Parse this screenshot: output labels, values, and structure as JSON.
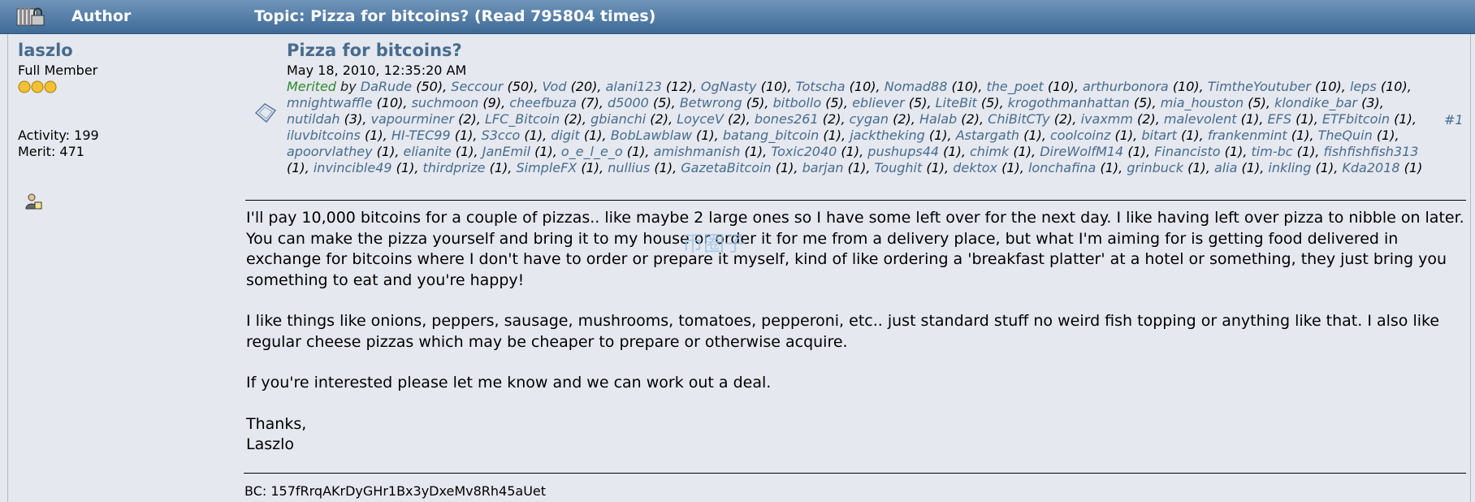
{
  "header": {
    "author_label": "Author",
    "topic_label": "Topic: Pizza for bitcoins?  (Read 795804 times)"
  },
  "poster": {
    "name": "laszlo",
    "rank": "Full Member",
    "star_count": 3,
    "activity": "Activity: 199",
    "merit": "Merit: 471"
  },
  "post": {
    "title": "Pizza for bitcoins?",
    "date": "May 18, 2010, 12:35:20 AM",
    "merited_label": "Merited",
    "merited_by_word": "by",
    "post_number": "#1",
    "merits": [
      {
        "user": "DaRude",
        "n": "(50)"
      },
      {
        "user": "Seccour",
        "n": "(50)"
      },
      {
        "user": "Vod",
        "n": "(20)"
      },
      {
        "user": "alani123",
        "n": "(12)"
      },
      {
        "user": "OgNasty",
        "n": "(10)"
      },
      {
        "user": "Totscha",
        "n": "(10)"
      },
      {
        "user": "Nomad88",
        "n": "(10)"
      },
      {
        "user": "the_poet",
        "n": "(10)"
      },
      {
        "user": "arthurbonora",
        "n": "(10)"
      },
      {
        "user": "TimtheYoutuber",
        "n": "(10)"
      },
      {
        "user": "leps",
        "n": "(10)"
      },
      {
        "user": "mnightwaffle",
        "n": "(10)"
      },
      {
        "user": "suchmoon",
        "n": "(9)"
      },
      {
        "user": "cheefbuza",
        "n": "(7)"
      },
      {
        "user": "d5000",
        "n": "(5)"
      },
      {
        "user": "Betwrong",
        "n": "(5)"
      },
      {
        "user": "bitbollo",
        "n": "(5)"
      },
      {
        "user": "ebliever",
        "n": "(5)"
      },
      {
        "user": "LiteBit",
        "n": "(5)"
      },
      {
        "user": "krogothmanhattan",
        "n": "(5)"
      },
      {
        "user": "mia_houston",
        "n": "(5)"
      },
      {
        "user": "klondike_bar",
        "n": "(3)"
      },
      {
        "user": "nutildah",
        "n": "(3)"
      },
      {
        "user": "vapourminer",
        "n": "(2)"
      },
      {
        "user": "LFC_Bitcoin",
        "n": "(2)"
      },
      {
        "user": "gbianchi",
        "n": "(2)"
      },
      {
        "user": "LoyceV",
        "n": "(2)"
      },
      {
        "user": "bones261",
        "n": "(2)"
      },
      {
        "user": "cygan",
        "n": "(2)"
      },
      {
        "user": "Halab",
        "n": "(2)"
      },
      {
        "user": "ChiBitCTy",
        "n": "(2)"
      },
      {
        "user": "ivaxmm",
        "n": "(2)"
      },
      {
        "user": "malevolent",
        "n": "(1)"
      },
      {
        "user": "EFS",
        "n": "(1)"
      },
      {
        "user": "ETFbitcoin",
        "n": "(1)"
      },
      {
        "user": "iluvbitcoins",
        "n": "(1)"
      },
      {
        "user": "HI-TEC99",
        "n": "(1)"
      },
      {
        "user": "S3cco",
        "n": "(1)"
      },
      {
        "user": "digit",
        "n": "(1)"
      },
      {
        "user": "BobLawblaw",
        "n": "(1)"
      },
      {
        "user": "batang_bitcoin",
        "n": "(1)"
      },
      {
        "user": "jacktheking",
        "n": "(1)"
      },
      {
        "user": "Astargath",
        "n": "(1)"
      },
      {
        "user": "coolcoinz",
        "n": "(1)"
      },
      {
        "user": "bitart",
        "n": "(1)"
      },
      {
        "user": "frankenmint",
        "n": "(1)"
      },
      {
        "user": "TheQuin",
        "n": "(1)"
      },
      {
        "user": "apoorvlathey",
        "n": "(1)"
      },
      {
        "user": "elianite",
        "n": "(1)"
      },
      {
        "user": "JanEmil",
        "n": "(1)"
      },
      {
        "user": "o_e_l_e_o",
        "n": "(1)"
      },
      {
        "user": "amishmanish",
        "n": "(1)"
      },
      {
        "user": "Toxic2040",
        "n": "(1)"
      },
      {
        "user": "pushups44",
        "n": "(1)"
      },
      {
        "user": "chimk",
        "n": "(1)"
      },
      {
        "user": "DireWolfM14",
        "n": "(1)"
      },
      {
        "user": "Financisto",
        "n": "(1)"
      },
      {
        "user": "tim-bc",
        "n": "(1)"
      },
      {
        "user": "fishfishfish313",
        "n": "(1)"
      },
      {
        "user": "invincible49",
        "n": "(1)"
      },
      {
        "user": "thirdprize",
        "n": "(1)"
      },
      {
        "user": "SimpleFX",
        "n": "(1)"
      },
      {
        "user": "nullius",
        "n": "(1)"
      },
      {
        "user": "GazetaBitcoin",
        "n": "(1)"
      },
      {
        "user": "barjan",
        "n": "(1)"
      },
      {
        "user": "Toughit",
        "n": "(1)"
      },
      {
        "user": "dektox",
        "n": "(1)"
      },
      {
        "user": "lonchafina",
        "n": "(1)"
      },
      {
        "user": "grinbuck",
        "n": "(1)"
      },
      {
        "user": "alia",
        "n": "(1)"
      },
      {
        "user": "inkling",
        "n": "(1)"
      },
      {
        "user": "Kda2018",
        "n": "(1)"
      }
    ],
    "body": [
      "I'll pay 10,000 bitcoins for a couple of pizzas.. like maybe 2 large ones so I have some left over for the next day.  I like having left over pizza to nibble on later.  You can make the pizza yourself and bring it to my house or order it for me from a delivery place, but what I'm aiming for is getting food delivered in exchange for bitcoins where I don't have to order or prepare it myself, kind of like ordering a 'breakfast platter' at a hotel or something, they just bring you something to eat and you're happy!",
      "I like things like onions, peppers, sausage, mushrooms, tomatoes, pepperoni, etc.. just standard stuff no weird fish topping or anything like that.  I also like regular cheese pizzas which may be cheaper to prepare or otherwise acquire.",
      "If you're interested please let me know and we can work out a deal."
    ],
    "closing": "Thanks,",
    "signoff": "Laszlo",
    "signature": "BC: 157fRrqAKrDyGHr1Bx3yDxeMv8Rh45aUet"
  },
  "watermark": "币圈子",
  "colors": {
    "header_bg": "#547ea8",
    "page_bg": "#e5e8ef",
    "link": "#476c8e",
    "merited_green": "#2e8b2e"
  }
}
